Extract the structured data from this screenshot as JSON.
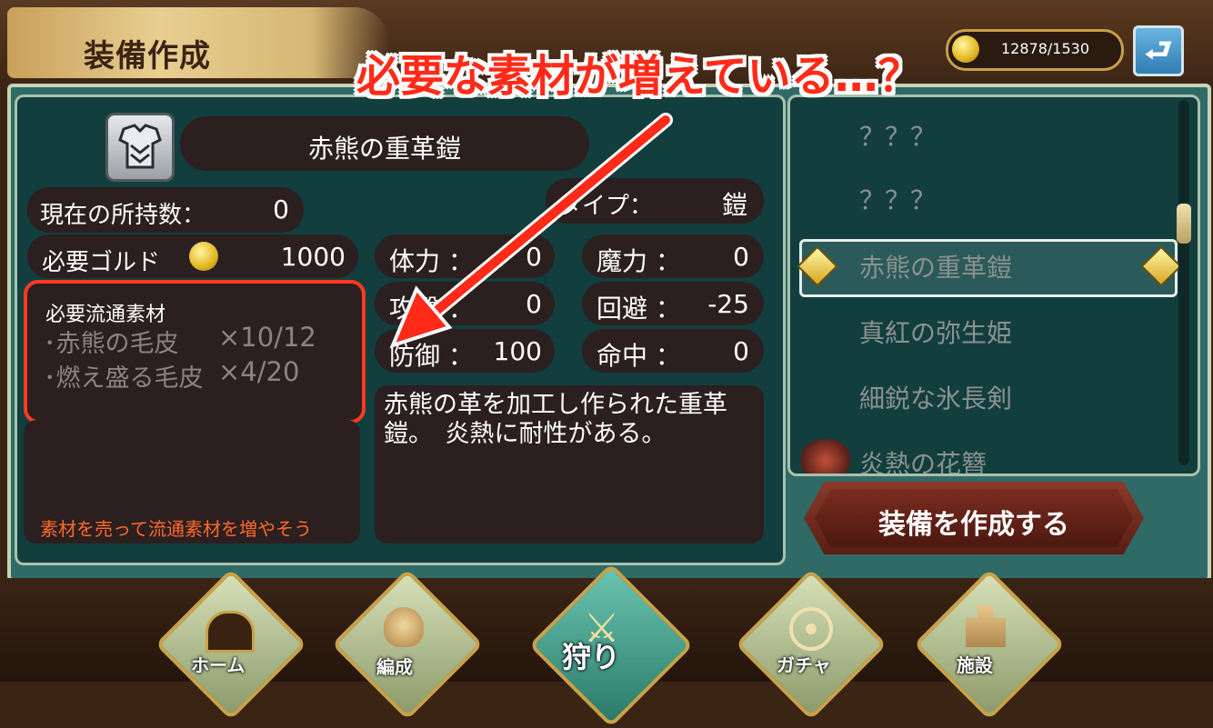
{
  "header": {
    "title": "装備作成",
    "currency_value": "12878/1530",
    "back_icon": "return-arrow-icon"
  },
  "annotation": {
    "caption": "必要な素材が増えている…？"
  },
  "item": {
    "name": "赤熊の重革鎧",
    "icon": "armor-icon"
  },
  "stats": {
    "owned_label": "現在の所持数：",
    "owned_value": "0",
    "gold_label": "必要ゴルド",
    "gold_value": "1000",
    "type_label": "タイプ：",
    "type_value": "鎧",
    "hp_label": "体力 ：",
    "hp_value": "0",
    "mp_label": "魔力 ：",
    "mp_value": "0",
    "atk_label": "攻撃 ：",
    "atk_value": "0",
    "eva_label": "回避 ：",
    "eva_value": "-25",
    "def_label": "防御 ：",
    "def_value": "100",
    "hit_label": "命中 ：",
    "hit_value": "0"
  },
  "materials": {
    "title": "必要流通素材",
    "items": [
      {
        "name": "･赤熊の毛皮",
        "qty": "×10/12"
      },
      {
        "name": "･燃え盛る毛皮",
        "qty": "×4/20"
      }
    ],
    "hint": "素材を売って流通素材を増やそう"
  },
  "description": "赤熊の革を加工し作られた重革鎧。　炎熱に耐性がある。",
  "recipe_list": {
    "items": [
      "？？？",
      "？？？",
      "赤熊の重革鎧",
      "真紅の弥生姫",
      "細鋭な氷長剣",
      "炎熱の花簪"
    ],
    "selected_index": 2
  },
  "create_button": "装備を作成する",
  "nav": {
    "items": [
      {
        "label": "ホーム",
        "icon": "home-gate-icon"
      },
      {
        "label": "編成",
        "icon": "character-face-icon"
      },
      {
        "label": "狩り",
        "icon": "crossed-swords-icon"
      },
      {
        "label": "ガチャ",
        "icon": "compass-wheel-icon"
      },
      {
        "label": "施設",
        "icon": "building-icon"
      }
    ]
  },
  "colors": {
    "highlight_red": "#ff3b1f",
    "panel_teal": "#123e3e",
    "pill_dark": "#2b1f1f"
  }
}
